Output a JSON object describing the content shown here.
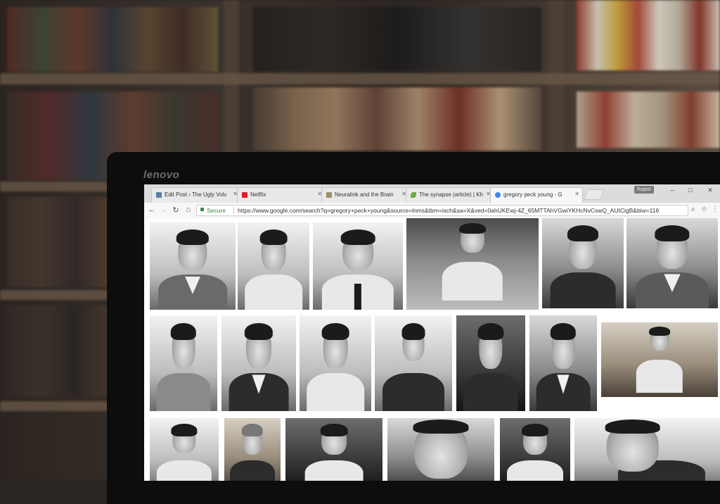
{
  "laptop": {
    "brand": "lenovo"
  },
  "browser": {
    "tabs": [
      {
        "title": "Edit Post ‹ The Ugly Volv",
        "icon": "wordpress-icon",
        "color": "#5b7fa8"
      },
      {
        "title": "Netflix",
        "icon": "netflix-icon",
        "color": "#d81f26"
      },
      {
        "title": "Neuralink and the Brain",
        "icon": "page-icon",
        "color": "#9c8f6a"
      },
      {
        "title": "The synapse (article) | Kh",
        "icon": "leaf-icon",
        "color": "#6cad3f"
      },
      {
        "title": "gregory peck young - G",
        "icon": "google-icon",
        "color": "#4285f4",
        "active": true
      }
    ],
    "profile": "Rajeel",
    "window_controls": {
      "minimize": "–",
      "maximize": "□",
      "close": "✕"
    },
    "nav": {
      "back": "←",
      "forward": "→",
      "reload": "↻",
      "home": "⌂"
    },
    "secure_label": "Secure",
    "url": "https://www.google.com/search?q=gregory+peck+young&source=lnms&tbm=isch&sa=X&ved=0ahUKEwj-4Z_65MTTAhVGwiYKHcNvCswQ_AUICigB&biw=116",
    "toolbar_icons": {
      "zoom": "⌕",
      "bookmark": "☆",
      "menu": "⋮"
    }
  },
  "image_results": {
    "query": "gregory peck young",
    "rows": [
      [
        "smiling portrait in tweed jacket",
        "leaning in white shirt",
        "portrait with dark tie",
        "at desk outdoors",
        "smiling head turned",
        "portrait in suit"
      ],
      [
        "portrait in sweater",
        "portrait with bow tie",
        "hand on chin",
        "writing at desk",
        "hand at collar",
        "pipe in mouth",
        "seated on sand"
      ],
      [
        "standing in white shirt",
        "older with mustache",
        "reclining portrait",
        "close-up",
        "seated portrait",
        "close-up head tilt"
      ]
    ]
  }
}
